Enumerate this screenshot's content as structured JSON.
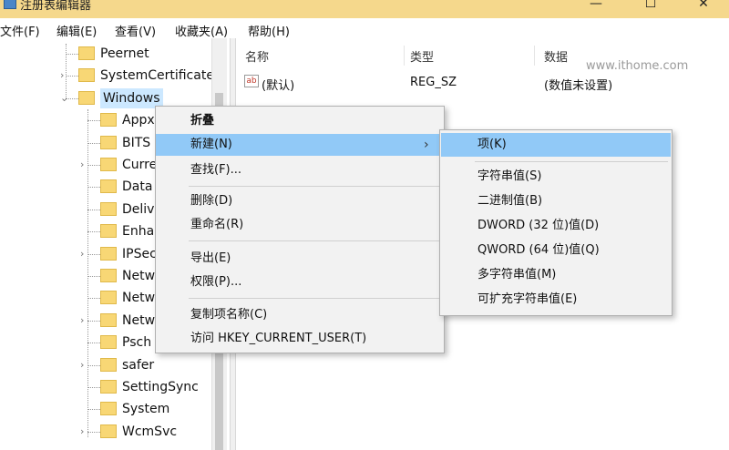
{
  "window": {
    "title": "注册表编辑器",
    "minimize": "—",
    "maximize": "☐",
    "close": "✕"
  },
  "menu": [
    "文件(F)",
    "编辑(E)",
    "查看(V)",
    "收藏夹(A)",
    "帮助(H)"
  ],
  "tree": {
    "items": [
      {
        "label": "Peernet",
        "expandable": false
      },
      {
        "label": "SystemCertificate",
        "expandable": true
      },
      {
        "label": "Windows",
        "expandable": true,
        "expanded": true,
        "selected": true
      },
      {
        "label": "Appx",
        "expandable": false
      },
      {
        "label": "BITS",
        "expandable": false
      },
      {
        "label": "Curre",
        "expandable": true
      },
      {
        "label": "Data",
        "expandable": false
      },
      {
        "label": "Deliv",
        "expandable": false
      },
      {
        "label": "Enha",
        "expandable": false
      },
      {
        "label": "IPSec",
        "expandable": true
      },
      {
        "label": "Netw",
        "expandable": false
      },
      {
        "label": "Netw",
        "expandable": false
      },
      {
        "label": "Netw",
        "expandable": true
      },
      {
        "label": "Psch",
        "expandable": false
      },
      {
        "label": "safer",
        "expandable": true
      },
      {
        "label": "SettingSync",
        "expandable": false
      },
      {
        "label": "System",
        "expandable": false
      },
      {
        "label": "WcmSvc",
        "expandable": true
      }
    ]
  },
  "list": {
    "columns": [
      "名称",
      "类型",
      "数据"
    ],
    "rows": [
      {
        "name": "(默认)",
        "type": "REG_SZ",
        "data": "(数值未设置)",
        "icon": "ab-string-icon"
      }
    ]
  },
  "watermark": "www.ithome.com",
  "context_menu": {
    "items": [
      {
        "label": "折叠",
        "bold": true
      },
      {
        "label": "新建(N)",
        "submenu": true,
        "active": true
      },
      {
        "label": "查找(F)..."
      },
      {
        "label": "删除(D)"
      },
      {
        "label": "重命名(R)"
      },
      {
        "label": "导出(E)"
      },
      {
        "label": "权限(P)..."
      },
      {
        "label": "复制项名称(C)"
      },
      {
        "label": "访问 HKEY_CURRENT_USER(T)"
      }
    ],
    "submenu_arrow": "›"
  },
  "submenu": {
    "items": [
      {
        "label": "项(K)",
        "active": true
      },
      {
        "label": "字符串值(S)"
      },
      {
        "label": "二进制值(B)"
      },
      {
        "label": "DWORD (32 位)值(D)"
      },
      {
        "label": "QWORD (64 位)值(Q)"
      },
      {
        "label": "多字符串值(M)"
      },
      {
        "label": "可扩充字符串值(E)"
      }
    ]
  },
  "colors": {
    "titlebar": "#f5d88c",
    "menu_highlight": "#91c9f7",
    "folder": "#f8d775",
    "selection": "#cce8ff"
  }
}
